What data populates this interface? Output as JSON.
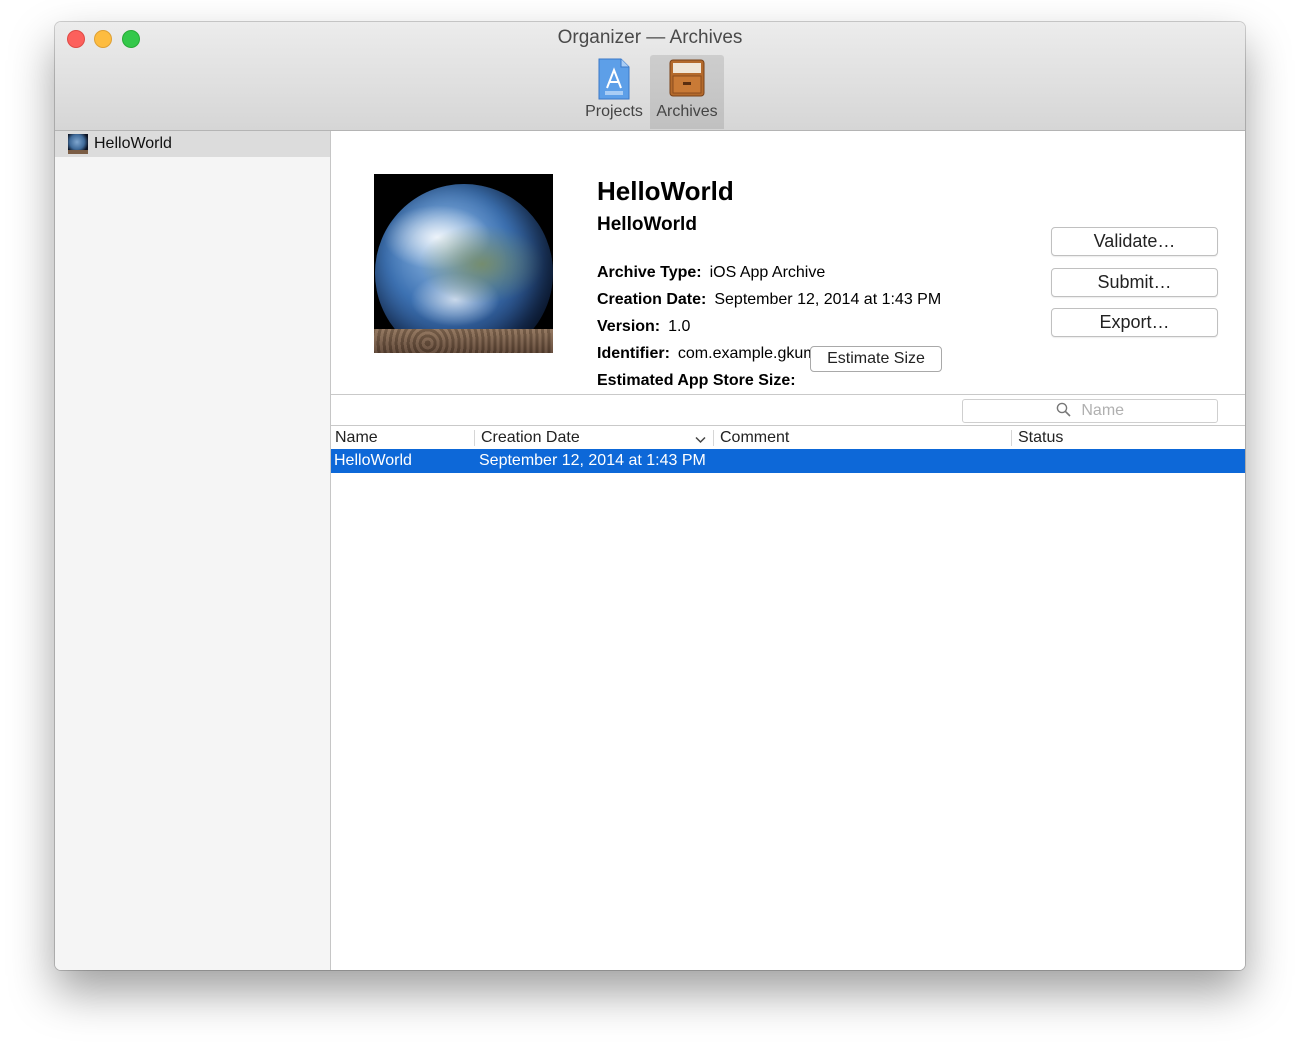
{
  "window": {
    "title": "Organizer — Archives"
  },
  "toolbar": {
    "items": [
      {
        "label": "Projects",
        "selected": false
      },
      {
        "label": "Archives",
        "selected": true
      }
    ]
  },
  "sidebar": {
    "items": [
      {
        "label": "HelloWorld",
        "selected": true
      }
    ]
  },
  "detail": {
    "title": "HelloWorld",
    "subtitle": "HelloWorld",
    "fields": {
      "archive_type_label": "Archive Type:",
      "archive_type": "iOS App Archive",
      "creation_date_label": "Creation Date:",
      "creation_date": "September 12, 2014 at 1:43 PM",
      "version_label": "Version:",
      "version": "1.0",
      "identifier_label": "Identifier:",
      "identifier": "com.example.gkumar.HelloWorld",
      "size_label": "Estimated App Store Size:"
    },
    "estimate_button": "Estimate Size",
    "actions": {
      "validate": "Validate…",
      "submit": "Submit…",
      "export": "Export…"
    }
  },
  "search": {
    "placeholder": "Name"
  },
  "table": {
    "columns": [
      "Name",
      "Creation Date",
      "Comment",
      "Status"
    ],
    "sorted_column": "Creation Date",
    "rows": [
      {
        "name": "HelloWorld",
        "creation_date": "September 12, 2014 at 1:43 PM",
        "comment": "",
        "status": "",
        "selected": true
      }
    ]
  },
  "colors": {
    "selection": "#0d68d8",
    "close": "#fc605c",
    "minimize": "#fdbc40",
    "zoom": "#34c84a"
  },
  "icons": {
    "projects": "xcode-project-document-icon",
    "archives": "archive-cabinet-icon",
    "search": "magnifier-icon",
    "sort": "chevron-down-icon"
  }
}
